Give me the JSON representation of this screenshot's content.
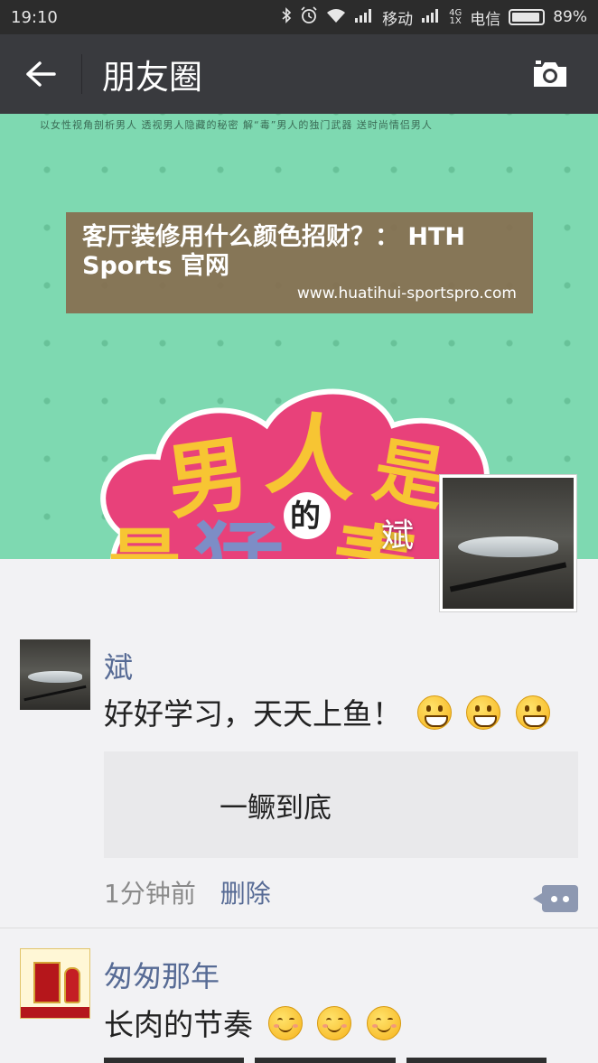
{
  "status_bar": {
    "time": "19:10",
    "carrier1": "移动",
    "network_4g": "4G",
    "network_1x": "1X",
    "carrier2": "电信",
    "battery": "89%",
    "icons": [
      "bluetooth-icon",
      "alarm-icon",
      "wifi-icon",
      "signal-icon",
      "battery-icon"
    ]
  },
  "header": {
    "title": "朋友圈",
    "back_icon": "arrow-left-icon",
    "camera_icon": "camera-icon"
  },
  "cover": {
    "top_line": "以女性视角剖析男人 透视男人隐藏的秘密 解“毒”男人的独门武器 送时尚情侣男人",
    "cloud_chars": [
      "男",
      "人",
      "是",
      "最",
      "的",
      "猛",
      "毒"
    ],
    "user_name": "斌",
    "ad_title": "客厅装修用什么颜色招财？： HTH Sports 官网",
    "ad_url": "www.huatihui-sportspro.com"
  },
  "posts": [
    {
      "author": "斌",
      "text": "好好学习，天天上鱼！",
      "emoji_count": 3,
      "share_title": "一鳜到底",
      "time": "1分钟前",
      "delete_label": "删除"
    },
    {
      "author": "匆匆那年",
      "text": "长肉的节奏",
      "emoji_count": 3
    }
  ],
  "colors": {
    "title_bar": "#393a3e",
    "status_bar": "#2c2c2c",
    "link_blue": "#576b95",
    "cover_green": "#7ed9b1",
    "cloud_pink": "#e8417a"
  }
}
